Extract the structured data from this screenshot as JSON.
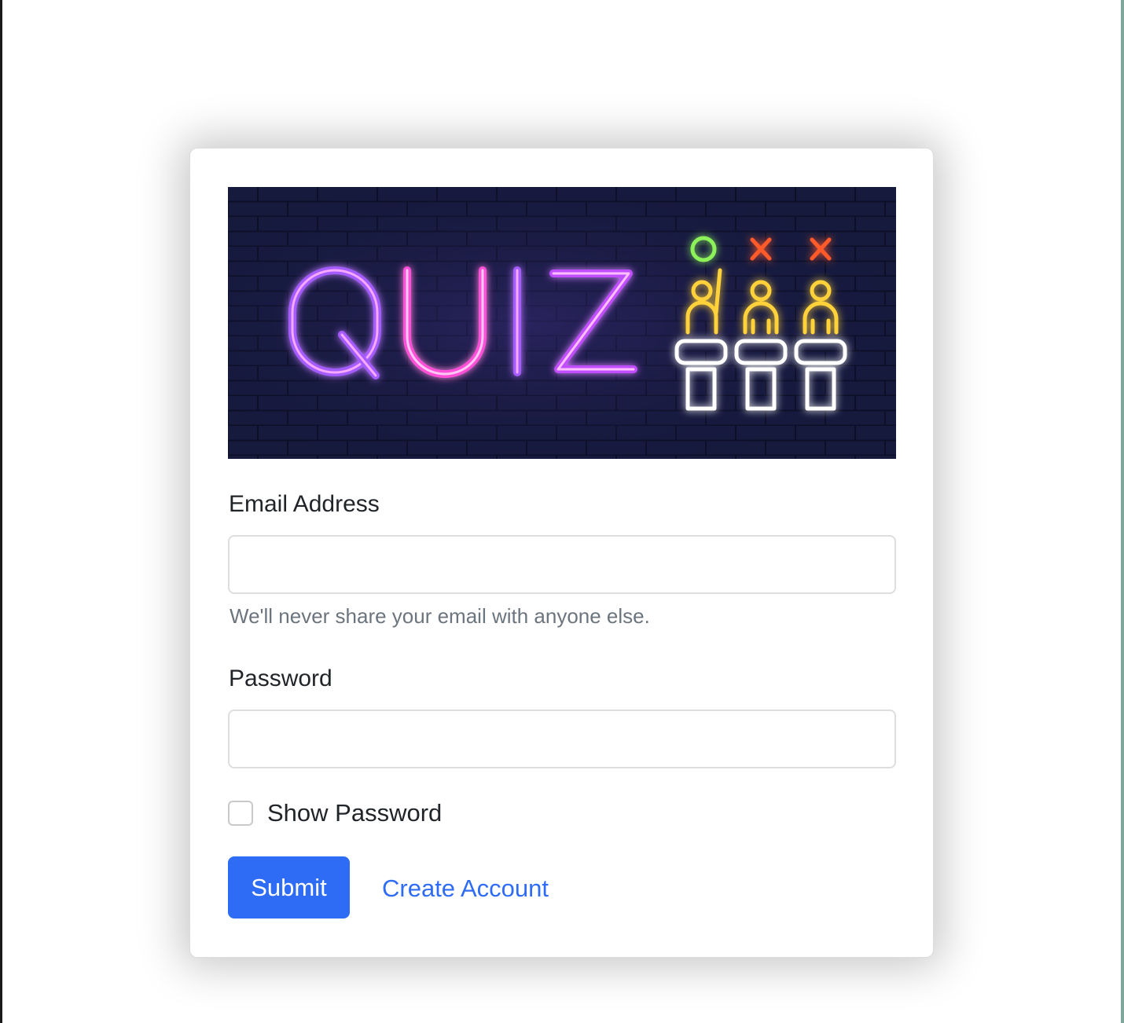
{
  "banner": {
    "text": "QUIZ",
    "markers": [
      "circle-icon",
      "x-icon",
      "x-icon"
    ],
    "colors": {
      "background": "#161a3d",
      "letters": "#c84dff",
      "people": "#ffd23a",
      "circle": "#8df25a",
      "cross": "#ff5a2a",
      "podium": "#ffffff"
    }
  },
  "form": {
    "email_label": "Email Address",
    "email_value": "",
    "email_help": "We'll never share your email with anyone else.",
    "password_label": "Password",
    "password_value": "",
    "show_password_label": "Show Password",
    "show_password_checked": false,
    "submit_label": "Submit",
    "create_account_label": "Create Account"
  },
  "colors": {
    "primary": "#2f6cf5",
    "text": "#212529",
    "muted": "#6c757d"
  }
}
